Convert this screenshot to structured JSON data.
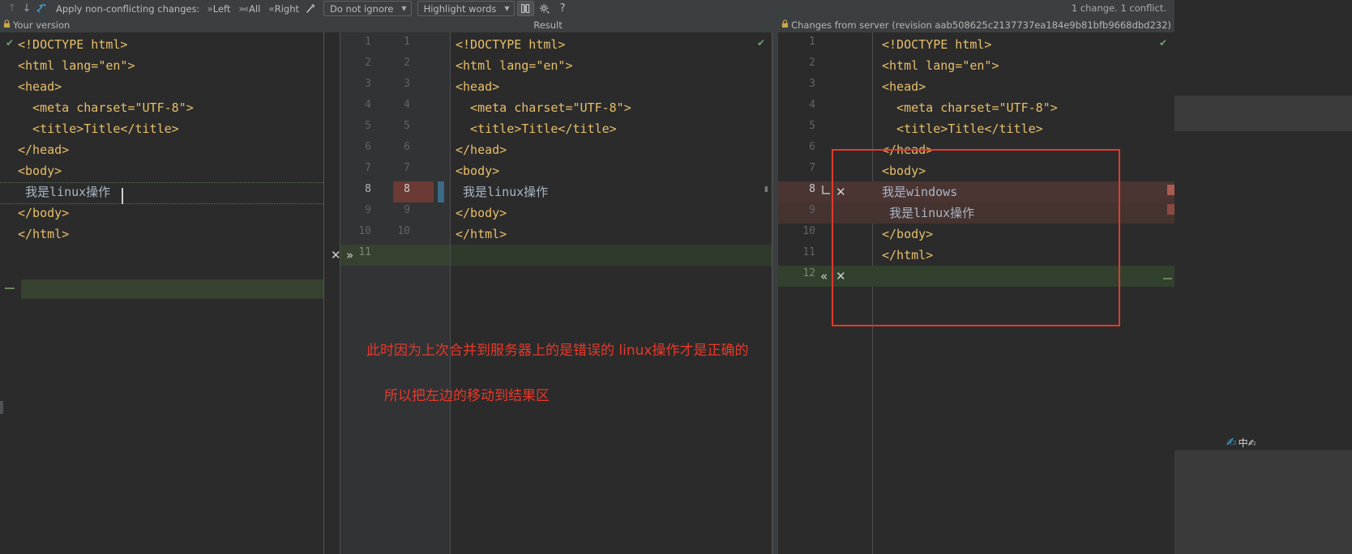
{
  "toolbar": {
    "prev_label": "↑",
    "next_label": "↓",
    "magic_label": "⤳",
    "apply_label": "Apply non-conflicting changes:",
    "left_label": "Left",
    "all_label": "All",
    "right_label": "Right",
    "wand_label": "⟋",
    "ignore_select": "Do not ignore",
    "highlight_select": "Highlight words",
    "columns_icon": "columns-icon",
    "settings_icon": "gear-icon",
    "help_label": "?",
    "status": "1 change. 1 conflict."
  },
  "panes": {
    "left": {
      "title": "Your version",
      "lock": "🔒",
      "lines": [
        {
          "n": "",
          "html": "doctype",
          "text": "<!DOCTYPE html>"
        },
        {
          "n": "",
          "html": "tag",
          "text": "<html lang=\"en\">"
        },
        {
          "n": "",
          "html": "tag",
          "text": "<head>"
        },
        {
          "n": "",
          "html": "tag",
          "text": "  <meta charset=\"UTF-8\">"
        },
        {
          "n": "",
          "html": "tag",
          "text": "  <title>Title</title>"
        },
        {
          "n": "",
          "html": "tag",
          "text": "</head>"
        },
        {
          "n": "",
          "html": "tag",
          "text": "<body>"
        },
        {
          "n": "",
          "html": "txt",
          "text": " 我是linux操作"
        },
        {
          "n": "",
          "html": "tag",
          "text": "</body>"
        },
        {
          "n": "",
          "html": "tag",
          "text": "</html>"
        }
      ]
    },
    "middle": {
      "title": "Result",
      "lines": [
        {
          "a": "1",
          "b": "1",
          "text": "<!DOCTYPE html>"
        },
        {
          "a": "2",
          "b": "2",
          "text": "<html lang=\"en\">"
        },
        {
          "a": "3",
          "b": "3",
          "text": "<head>"
        },
        {
          "a": "4",
          "b": "4",
          "text": "  <meta charset=\"UTF-8\">"
        },
        {
          "a": "5",
          "b": "5",
          "text": "  <title>Title</title>"
        },
        {
          "a": "6",
          "b": "6",
          "text": "</head>"
        },
        {
          "a": "7",
          "b": "7",
          "text": "<body>"
        },
        {
          "a": "8",
          "b": "8",
          "text": " 我是linux操作"
        },
        {
          "a": "9",
          "b": "9",
          "text": "</body>"
        },
        {
          "a": "10",
          "b": "10",
          "text": "</html>"
        },
        {
          "a": "11",
          "b": "",
          "text": ""
        }
      ],
      "accept_x": "✕",
      "accept_chevron": "»"
    },
    "right": {
      "title": "Changes from server (revision aab508625c2137737ea184e9b81bfb9668dbd232)",
      "lock": "🔒",
      "lines": [
        {
          "n": "1",
          "text": "<!DOCTYPE html>"
        },
        {
          "n": "2",
          "text": "<html lang=\"en\">"
        },
        {
          "n": "3",
          "text": "<head>"
        },
        {
          "n": "4",
          "text": "  <meta charset=\"UTF-8\">"
        },
        {
          "n": "5",
          "text": "  <title>Title</title>"
        },
        {
          "n": "6",
          "text": "</head>"
        },
        {
          "n": "7",
          "text": "<body>"
        },
        {
          "n": "8",
          "text": "我是windows"
        },
        {
          "n": "9",
          "text": " 我是linux操作"
        },
        {
          "n": "10",
          "text": "</body>"
        },
        {
          "n": "11",
          "text": "</html>"
        },
        {
          "n": "12",
          "text": ""
        }
      ],
      "reject_x": "✕",
      "reject_chevron": "«",
      "corner_glyph": "⌐"
    }
  },
  "annotations": {
    "line1": "此时因为上次合并到服务器上的是错误的 linux操作才是正确的",
    "line2": "所以把左边的移动到结果区",
    "color": "#e8392b"
  },
  "desktop": {
    "ime_label": "中✍"
  },
  "colors": {
    "background": "#3c3f41",
    "editor_bg": "#2b2b2b",
    "gutter_bg": "#313335",
    "conflict_red": "#4a3533",
    "insert_green": "#32402e",
    "accent_blue": "#4f9fd4",
    "tag_color": "#e8bf6a",
    "attr_color": "#9876aa",
    "string_color": "#6a8759",
    "text_color": "#a9b7c6"
  }
}
